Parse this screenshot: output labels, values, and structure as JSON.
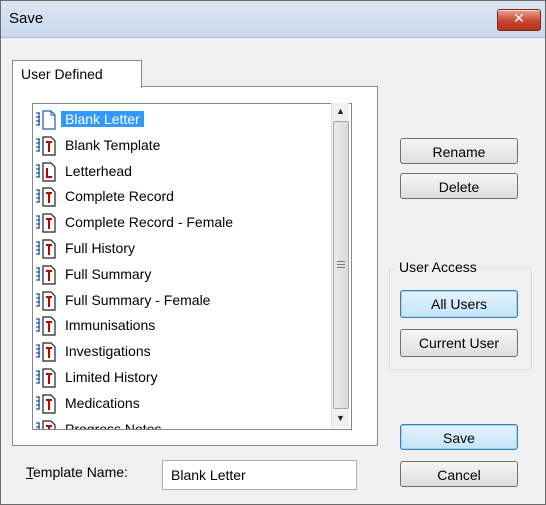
{
  "window": {
    "title": "Save",
    "close_glyph": "✕"
  },
  "tab": {
    "label": "User Defined"
  },
  "list": {
    "items": [
      {
        "label": "Blank Letter",
        "icon": "blank-letter-icon",
        "selected": true
      },
      {
        "label": "Blank Template",
        "icon": "template-icon"
      },
      {
        "label": "Letterhead",
        "icon": "letterhead-icon"
      },
      {
        "label": "Complete Record",
        "icon": "template-icon"
      },
      {
        "label": "Complete Record - Female",
        "icon": "template-icon"
      },
      {
        "label": "Full History",
        "icon": "template-icon"
      },
      {
        "label": "Full Summary",
        "icon": "template-icon"
      },
      {
        "label": "Full Summary - Female",
        "icon": "template-icon"
      },
      {
        "label": "Immunisations",
        "icon": "template-icon"
      },
      {
        "label": "Investigations",
        "icon": "template-icon"
      },
      {
        "label": "Limited History",
        "icon": "template-icon"
      },
      {
        "label": "Medications",
        "icon": "template-icon"
      },
      {
        "label": "Progress Notes",
        "icon": "template-icon"
      }
    ]
  },
  "buttons": {
    "rename": "Rename",
    "delete": "Delete",
    "save": "Save",
    "cancel": "Cancel"
  },
  "user_access": {
    "label": "User Access",
    "all_users": "All Users",
    "current_user": "Current User",
    "selected": "All Users"
  },
  "template_name": {
    "label_first_letter": "T",
    "label_rest": "emplate Name:",
    "value": "Blank Letter"
  },
  "colors": {
    "selection": "#3399ff",
    "close_red": "#c7472d",
    "doc_red": "#c00000",
    "doc_blue": "#1c5bb5"
  }
}
